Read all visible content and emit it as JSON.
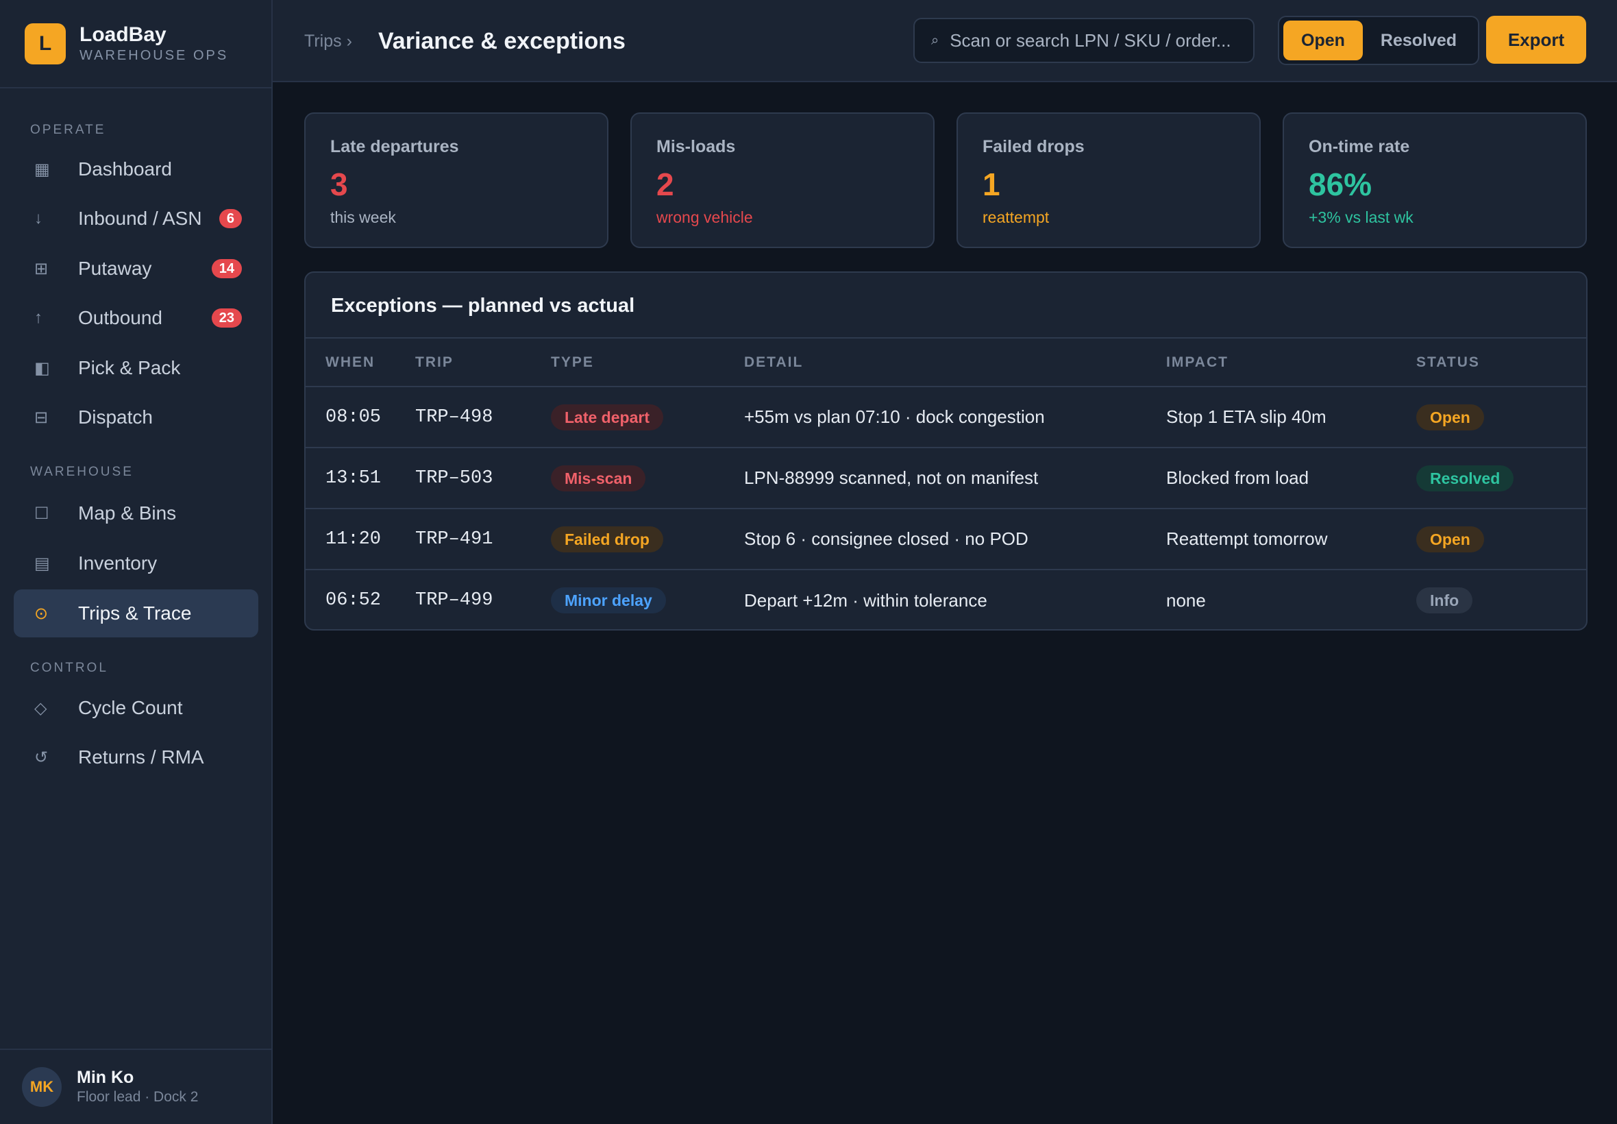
{
  "brand": {
    "logo_letter": "L",
    "name": "LoadBay",
    "subtitle": "WAREHOUSE OPS"
  },
  "sidebar": {
    "sections": [
      {
        "label": "OPERATE"
      },
      {
        "label": "WAREHOUSE"
      },
      {
        "label": "CONTROL"
      }
    ],
    "items": [
      {
        "label": "Dashboard",
        "icon": "dashboard-icon",
        "glyph": "▦",
        "badge": ""
      },
      {
        "label": "Inbound / ASN",
        "icon": "arrow-down-icon",
        "glyph": "↓",
        "badge": "6"
      },
      {
        "label": "Putaway",
        "icon": "grid-icon",
        "glyph": "⊞",
        "badge": "14"
      },
      {
        "label": "Outbound",
        "icon": "arrow-up-icon",
        "glyph": "↑",
        "badge": "23"
      },
      {
        "label": "Pick & Pack",
        "icon": "box-icon",
        "glyph": "◧",
        "badge": ""
      },
      {
        "label": "Dispatch",
        "icon": "truck-icon",
        "glyph": "⊟",
        "badge": ""
      },
      {
        "label": "Map & Bins",
        "icon": "square-icon",
        "glyph": "☐",
        "badge": ""
      },
      {
        "label": "Inventory",
        "icon": "stack-icon",
        "glyph": "▤",
        "badge": ""
      },
      {
        "label": "Trips & Trace",
        "icon": "target-icon",
        "glyph": "⊙",
        "badge": "",
        "active": true
      },
      {
        "label": "Cycle Count",
        "icon": "diamond-icon",
        "glyph": "◇",
        "badge": ""
      },
      {
        "label": "Returns / RMA",
        "icon": "undo-icon",
        "glyph": "↺",
        "badge": ""
      }
    ]
  },
  "user": {
    "initials": "MK",
    "name": "Min Ko",
    "role": "Floor lead · Dock 2"
  },
  "header": {
    "breadcrumb": "Trips ›",
    "title": "Variance & exceptions",
    "search_placeholder": "Scan or search LPN / SKU / order...",
    "search_glyph": "⌕",
    "filter_open": "Open",
    "filter_resolved": "Resolved",
    "export_label": "Export"
  },
  "kpis": [
    {
      "label": "Late departures",
      "value": "3",
      "sub": "this week",
      "value_color": "#e5484d",
      "sub_color": "#aab4c3"
    },
    {
      "label": "Mis-loads",
      "value": "2",
      "sub": "wrong vehicle",
      "value_color": "#e5484d",
      "sub_color": "#e5484d"
    },
    {
      "label": "Failed drops",
      "value": "1",
      "sub": "reattempt",
      "value_color": "#f5a623",
      "sub_color": "#f5a623"
    },
    {
      "label": "On-time rate",
      "value": "86%",
      "sub": "+3% vs last wk",
      "value_color": "#2ec4a0",
      "sub_color": "#2ec4a0"
    }
  ],
  "table": {
    "title": "Exceptions — planned vs actual",
    "columns": [
      "WHEN",
      "TRIP",
      "TYPE",
      "DETAIL",
      "IMPACT",
      "STATUS"
    ],
    "rows": [
      {
        "when": "08:05",
        "trip": "TRP–498",
        "type": "Late depart",
        "type_kind": "red",
        "detail": "+55m vs plan 07:10 · dock congestion",
        "impact": "Stop 1 ETA slip 40m",
        "status": "Open",
        "status_kind": "open"
      },
      {
        "when": "13:51",
        "trip": "TRP–503",
        "type": "Mis-scan",
        "type_kind": "red",
        "detail": "LPN-88999 scanned, not on manifest",
        "impact": "Blocked from load",
        "status": "Resolved",
        "status_kind": "resolved"
      },
      {
        "when": "11:20",
        "trip": "TRP–491",
        "type": "Failed drop",
        "type_kind": "amber",
        "detail": "Stop 6 · consignee closed · no POD",
        "impact": "Reattempt tomorrow",
        "status": "Open",
        "status_kind": "open"
      },
      {
        "when": "06:52",
        "trip": "TRP–499",
        "type": "Minor delay",
        "type_kind": "blue",
        "detail": "Depart +12m · within tolerance",
        "impact": "none",
        "status": "Info",
        "status_kind": "info"
      }
    ]
  },
  "colors": {
    "accent": "#f5a623",
    "red": "#e5484d",
    "green": "#2ec4a0",
    "blue": "#4da3ff"
  }
}
